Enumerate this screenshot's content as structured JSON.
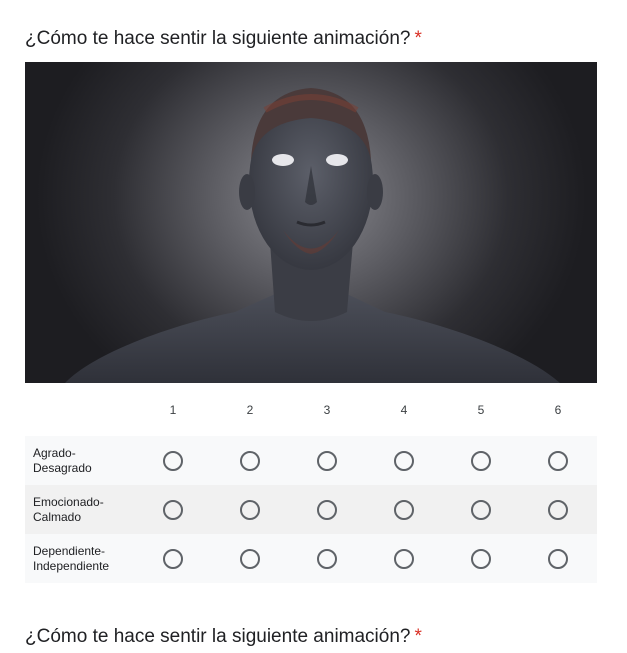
{
  "questions": [
    {
      "title": "¿Cómo te hace sentir la siguiente animación?",
      "required_mark": "*",
      "media": {
        "image_subject": "3d-rendered-male-head-and-shoulders"
      },
      "grid": {
        "columns": [
          "1",
          "2",
          "3",
          "4",
          "5",
          "6"
        ],
        "rows": [
          {
            "label": "Agrado-\nDesagrado"
          },
          {
            "label": "Emocionado-\nCalmado"
          },
          {
            "label": "Dependiente-\nIndependiente"
          }
        ]
      }
    },
    {
      "title": "¿Cómo te hace sentir la siguiente animación?",
      "required_mark": "*"
    }
  ],
  "colors": {
    "required": "#d93025",
    "radio_border": "#5f6368",
    "row_bg": "#f8f9fa",
    "row_bg_alt": "#f1f1f1"
  }
}
